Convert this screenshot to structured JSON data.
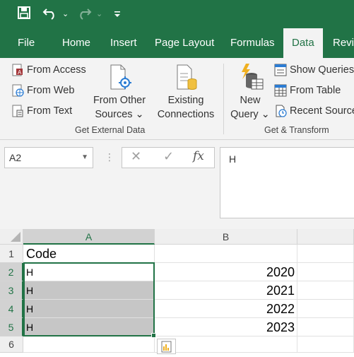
{
  "quick_access": {
    "icons": [
      "save-icon",
      "undo-icon",
      "redo-icon",
      "customize-icon"
    ],
    "dropdown_glyph": "⌄",
    "more_glyph": "⌄"
  },
  "tabs": [
    {
      "label": "File"
    },
    {
      "label": "Home"
    },
    {
      "label": "Insert"
    },
    {
      "label": "Page Layout"
    },
    {
      "label": "Formulas"
    },
    {
      "label": "Data",
      "active": true
    },
    {
      "label": "Revi"
    }
  ],
  "ribbon": {
    "get_external_data": {
      "label": "Get External Data",
      "from_access": "From Access",
      "from_web": "From Web",
      "from_text": "From Text",
      "from_other_sources_line1": "From Other",
      "from_other_sources_line2": "Sources ⌄",
      "existing_connections_line1": "Existing",
      "existing_connections_line2": "Connections"
    },
    "get_transform": {
      "label": "Get & Transform",
      "new_query_line1": "New",
      "new_query_line2": "Query ⌄",
      "show_queries": "Show Queries",
      "from_table": "From Table",
      "recent_sources": "Recent Sources"
    }
  },
  "formula_bar": {
    "name_box": "A2",
    "cancel_glyph": "✕",
    "enter_glyph": "✓",
    "fx_glyph": "fx",
    "content": "H"
  },
  "sheet": {
    "columns": [
      "A",
      "B"
    ],
    "rows": [
      {
        "num": "1",
        "a": "Code",
        "b": ""
      },
      {
        "num": "2",
        "a": "H",
        "b": "2020"
      },
      {
        "num": "3",
        "a": "H",
        "b": "2021"
      },
      {
        "num": "4",
        "a": "H",
        "b": "2022"
      },
      {
        "num": "5",
        "a": "H",
        "b": "2023"
      },
      {
        "num": "6",
        "a": "",
        "b": ""
      }
    ]
  },
  "colors": {
    "excel_green": "#217346",
    "ribbon_bg": "#f3f3f3",
    "selection_shade": "#c6c6c6"
  }
}
